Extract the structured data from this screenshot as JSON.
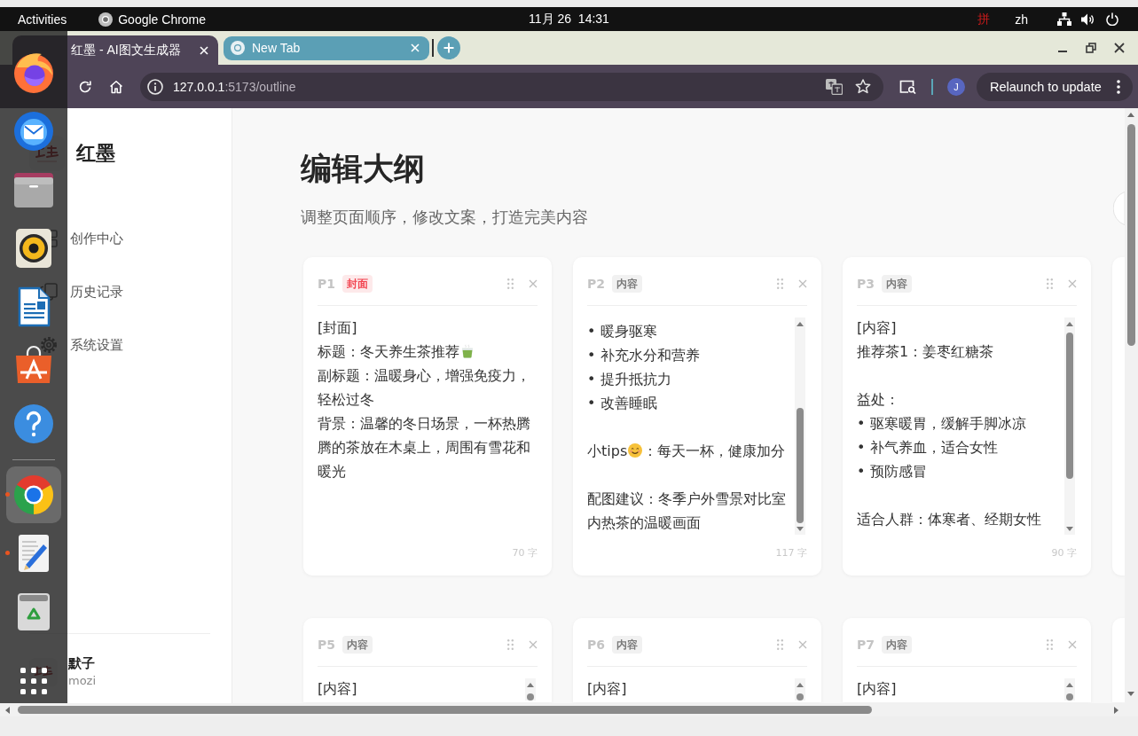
{
  "top_bar": {
    "activities": "Activities",
    "app_menu": "Google Chrome",
    "clock": "11月 26  14:31",
    "input_method": "拼",
    "language": "zh"
  },
  "browser": {
    "tabs": [
      {
        "kind": "page",
        "title": "红墨 - AI图文生成器",
        "selected": true
      },
      {
        "kind": "new_tab",
        "title": "New Tab",
        "selected": false
      }
    ],
    "address": {
      "host": "127.0.0.1",
      "path": ":5173/outline"
    },
    "profile": "J",
    "relaunch": "Relaunch to update"
  },
  "dock": {
    "sections": [
      {
        "apps": [
          {
            "kind": "firefox",
            "running": false,
            "selected": false
          },
          {
            "kind": "thunderbird",
            "running": false,
            "selected": false
          },
          {
            "kind": "files",
            "running": false,
            "selected": false
          },
          {
            "kind": "rhythmbox",
            "running": false,
            "selected": false
          },
          {
            "kind": "writer",
            "running": false,
            "selected": false
          },
          {
            "kind": "app_center",
            "running": false,
            "selected": false
          },
          {
            "kind": "help",
            "running": false,
            "selected": false
          }
        ]
      },
      {
        "apps": [
          {
            "kind": "chrome",
            "running": true,
            "selected": true
          },
          {
            "kind": "text_editor",
            "running": true,
            "selected": false
          },
          {
            "kind": "trash",
            "running": false,
            "selected": false
          }
        ]
      }
    ]
  },
  "sidebar": {
    "brand": "红墨",
    "nav": [
      {
        "kind": "create",
        "label": "创作中心",
        "selected": false
      },
      {
        "kind": "history",
        "label": "历史记录",
        "selected": false
      },
      {
        "kind": "settings",
        "label": "系统设置",
        "selected": false
      }
    ],
    "user": {
      "name": "默子",
      "handle": "mozi"
    }
  },
  "page": {
    "title": "编辑大纲",
    "subtitle": "调整页面顺序，修改文案，打造完美内容"
  },
  "card_rows": [
    {
      "clipped": false,
      "partial_card": true,
      "cards": [
        {
          "number": "P1",
          "tag": {
            "kind": "cover",
            "label": "封面"
          },
          "overflowing": false,
          "blocks": [
            {
              "lines": [
                {
                  "text": "[封面]"
                },
                {
                  "parts": [
                    {
                      "kind": "text",
                      "text": "标题：冬天养生茶推荐"
                    },
                    {
                      "kind": "tea_emoji"
                    }
                  ]
                },
                {
                  "text": "副标题：温暖身心，增强免疫力，轻松过冬"
                },
                {
                  "text": "背景：温馨的冬日场景，一杯热腾腾的茶放在木桌上，周围有雪花和暖光"
                }
              ]
            }
          ],
          "char_count": "70 字"
        },
        {
          "number": "P2",
          "tag": {
            "kind": "content",
            "label": "内容"
          },
          "overflowing": true,
          "scrolled": true,
          "blocks": [
            {
              "lines": [
                {
                  "text": "• 暖身驱寒"
                },
                {
                  "text": "• 补充水分和营养"
                },
                {
                  "text": "• 提升抵抗力"
                },
                {
                  "text": "• 改善睡眠"
                }
              ]
            },
            {
              "lines": [
                {
                  "parts": [
                    {
                      "kind": "text",
                      "text": "小tips"
                    },
                    {
                      "kind": "smile_emoji"
                    },
                    {
                      "kind": "text",
                      "text": "：每天一杯，健康加分"
                    }
                  ]
                }
              ]
            },
            {
              "lines": [
                {
                  "text": "配图建议：冬季户外雪景对比室内热茶的温暖画面"
                }
              ]
            }
          ],
          "char_count": "117 字"
        },
        {
          "number": "P3",
          "tag": {
            "kind": "content",
            "label": "内容"
          },
          "overflowing": true,
          "scrolled": false,
          "blocks": [
            {
              "lines": [
                {
                  "text": "[内容]"
                },
                {
                  "text": "推荐茶1：姜枣红糖茶"
                }
              ]
            },
            {
              "lines": [
                {
                  "text": "益处："
                },
                {
                  "text": "• 驱寒暖胃，缓解手脚冰凉"
                },
                {
                  "text": "• 补气养血，适合女性"
                },
                {
                  "text": "• 预防感冒"
                }
              ]
            },
            {
              "lines": [
                {
                  "text": "适合人群：体寒者、经期女性"
                }
              ]
            }
          ],
          "char_count": "90 字"
        }
      ]
    },
    {
      "clipped": true,
      "partial_card": true,
      "cards": [
        {
          "number": "P5",
          "tag": {
            "kind": "content",
            "label": "内容"
          },
          "overflowing": true,
          "scrolled": false,
          "blocks": [
            {
              "lines": [
                {
                  "text": "[内容]"
                }
              ]
            }
          ]
        },
        {
          "number": "P6",
          "tag": {
            "kind": "content",
            "label": "内容"
          },
          "overflowing": true,
          "scrolled": false,
          "blocks": [
            {
              "lines": [
                {
                  "text": "[内容]"
                }
              ]
            }
          ]
        },
        {
          "number": "P7",
          "tag": {
            "kind": "content",
            "label": "内容"
          },
          "overflowing": true,
          "scrolled": false,
          "blocks": [
            {
              "lines": [
                {
                  "text": "[内容]"
                }
              ]
            }
          ]
        }
      ]
    }
  ]
}
